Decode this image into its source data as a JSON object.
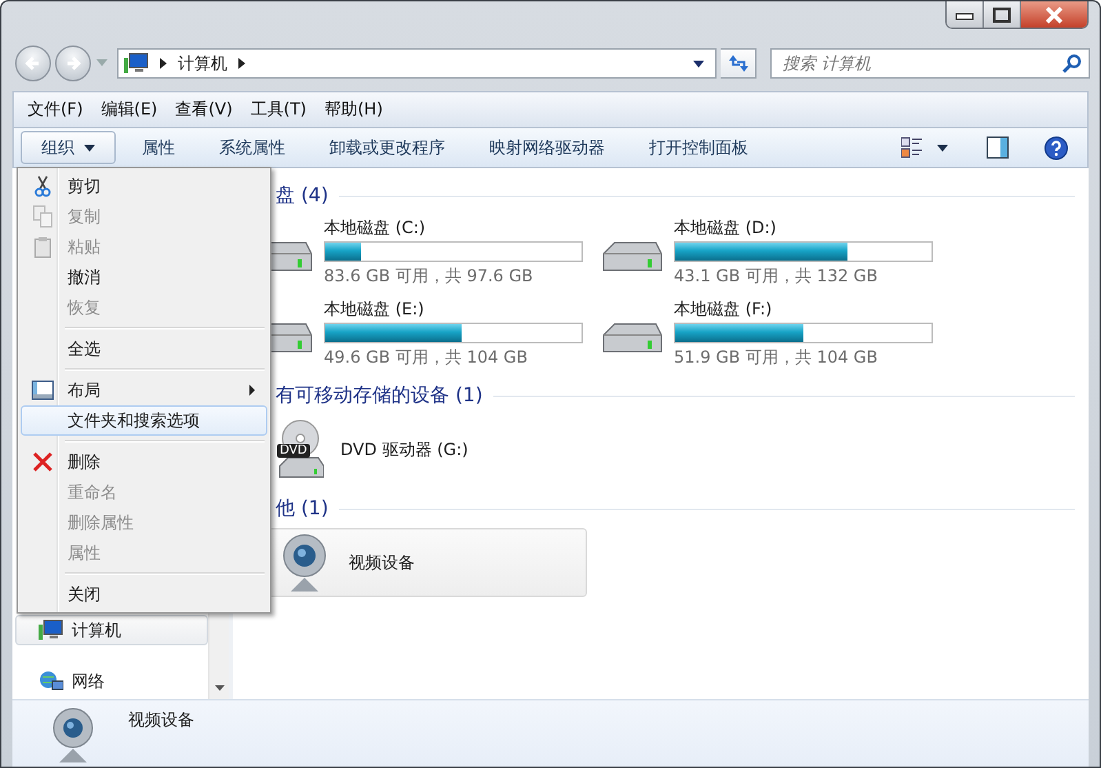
{
  "address": {
    "path": [
      "计算机"
    ]
  },
  "search": {
    "placeholder": "搜索 计算机"
  },
  "menu_bar": [
    "文件(F)",
    "编辑(E)",
    "查看(V)",
    "工具(T)",
    "帮助(H)"
  ],
  "toolbar": [
    {
      "label": "组织",
      "has_menu": true,
      "selected": true
    },
    {
      "label": "属性",
      "has_menu": false,
      "selected": false
    },
    {
      "label": "系统属性",
      "has_menu": false,
      "selected": false
    },
    {
      "label": "卸载或更改程序",
      "has_menu": false,
      "selected": false
    },
    {
      "label": "映射网络驱动器",
      "has_menu": false,
      "selected": false
    },
    {
      "label": "打开控制面板",
      "has_menu": false,
      "selected": false
    }
  ],
  "context_menu": {
    "groups": [
      {
        "items": [
          {
            "label": "剪切",
            "disabled": false,
            "selected": false,
            "submenu": false
          },
          {
            "label": "复制",
            "disabled": true,
            "selected": false,
            "submenu": false
          },
          {
            "label": "粘贴",
            "disabled": true,
            "selected": false,
            "submenu": false
          },
          {
            "label": "撤消",
            "disabled": false,
            "selected": false,
            "submenu": false
          },
          {
            "label": "恢复",
            "disabled": true,
            "selected": false,
            "submenu": false
          }
        ]
      },
      {
        "items": [
          {
            "label": "全选",
            "disabled": false,
            "selected": false,
            "submenu": false
          }
        ]
      },
      {
        "items": [
          {
            "label": "布局",
            "disabled": false,
            "selected": false,
            "submenu": true
          },
          {
            "label": "文件夹和搜索选项",
            "disabled": false,
            "selected": true,
            "submenu": false
          }
        ]
      },
      {
        "items": [
          {
            "label": "删除",
            "disabled": false,
            "selected": false,
            "submenu": false
          },
          {
            "label": "重命名",
            "disabled": true,
            "selected": false,
            "submenu": false
          },
          {
            "label": "删除属性",
            "disabled": true,
            "selected": false,
            "submenu": false
          },
          {
            "label": "属性",
            "disabled": true,
            "selected": false,
            "submenu": false
          }
        ]
      },
      {
        "items": [
          {
            "label": "关闭",
            "disabled": false,
            "selected": false,
            "submenu": false
          }
        ]
      }
    ]
  },
  "navigation": {
    "items": [
      {
        "label": "计算机",
        "selected": true
      },
      {
        "label": "网络",
        "selected": false
      }
    ]
  },
  "sections": [
    {
      "heading": "盘 (4)",
      "kind": "drives",
      "items": [
        {
          "name": "本地磁盘 (C:)",
          "level": 0.14,
          "reading": "83.6 GB 可用，共 97.6 GB"
        },
        {
          "name": "本地磁盘 (D:)",
          "level": 0.67,
          "reading": "43.1 GB 可用，共 132 GB"
        },
        {
          "name": "本地磁盘 (E:)",
          "level": 0.53,
          "reading": "49.6 GB 可用，共 104 GB"
        },
        {
          "name": "本地磁盘 (F:)",
          "level": 0.5,
          "reading": "51.9 GB 可用，共 104 GB"
        }
      ]
    },
    {
      "heading": "有可移动存储的设备 (1)",
      "kind": "removable",
      "items": [
        {
          "name": "DVD 驱动器 (G:)",
          "badge": "DVD",
          "selected": false
        }
      ]
    },
    {
      "heading": "他 (1)",
      "kind": "other",
      "items": [
        {
          "name": "视频设备",
          "selected": true
        }
      ]
    }
  ],
  "details": {
    "name": "视频设备"
  }
}
